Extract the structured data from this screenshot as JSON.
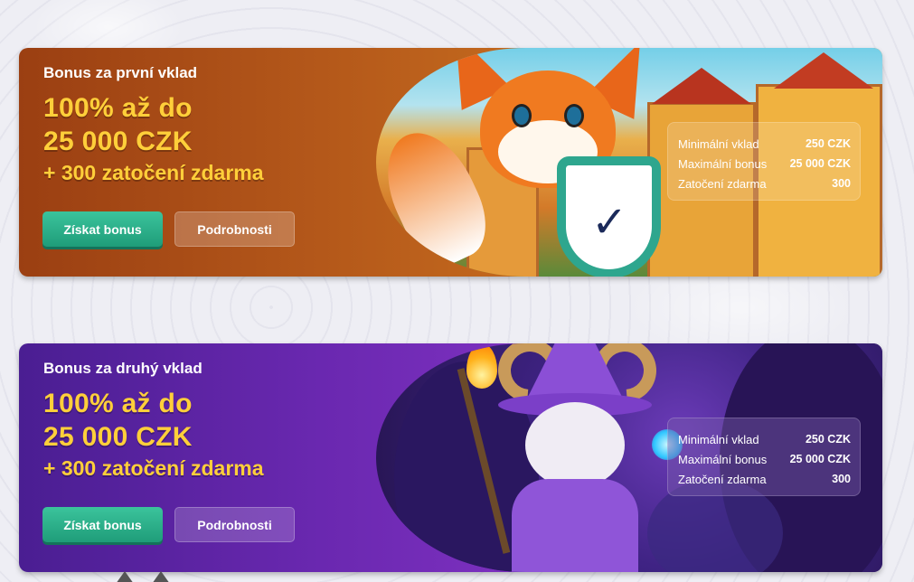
{
  "bonuses": [
    {
      "subtitle": "Bonus za první vklad",
      "headline_line1": "100% až do",
      "headline_line2": "25 000 CZK",
      "spins": "+ 300 zatočení zdarma",
      "primary_button": "Získat bonus",
      "secondary_button": "Podrobnosti",
      "info": [
        {
          "label": "Minimální vklad",
          "value": "250 CZK"
        },
        {
          "label": "Maximální bonus",
          "value": "25 000 CZK"
        },
        {
          "label": "Zatočení zdarma",
          "value": "300"
        }
      ],
      "mascot": "fox-knight-with-shield"
    },
    {
      "subtitle": "Bonus za druhý vklad",
      "headline_line1": "100% až do",
      "headline_line2": "25 000 CZK",
      "spins": "+ 300 zatočení zdarma",
      "primary_button": "Získat bonus",
      "secondary_button": "Podrobnosti",
      "info": [
        {
          "label": "Minimální vklad",
          "value": "250 CZK"
        },
        {
          "label": "Maximální bonus",
          "value": "25 000 CZK"
        },
        {
          "label": "Zatočení zdarma",
          "value": "300"
        }
      ],
      "mascot": "goat-wizard-with-staff"
    }
  ],
  "colors": {
    "page_background": "#eeeef4",
    "headline": "#ffcf3a",
    "primary_button": "#2bb08a",
    "first_card": "#b4581a",
    "second_card": "#6a28b0"
  }
}
